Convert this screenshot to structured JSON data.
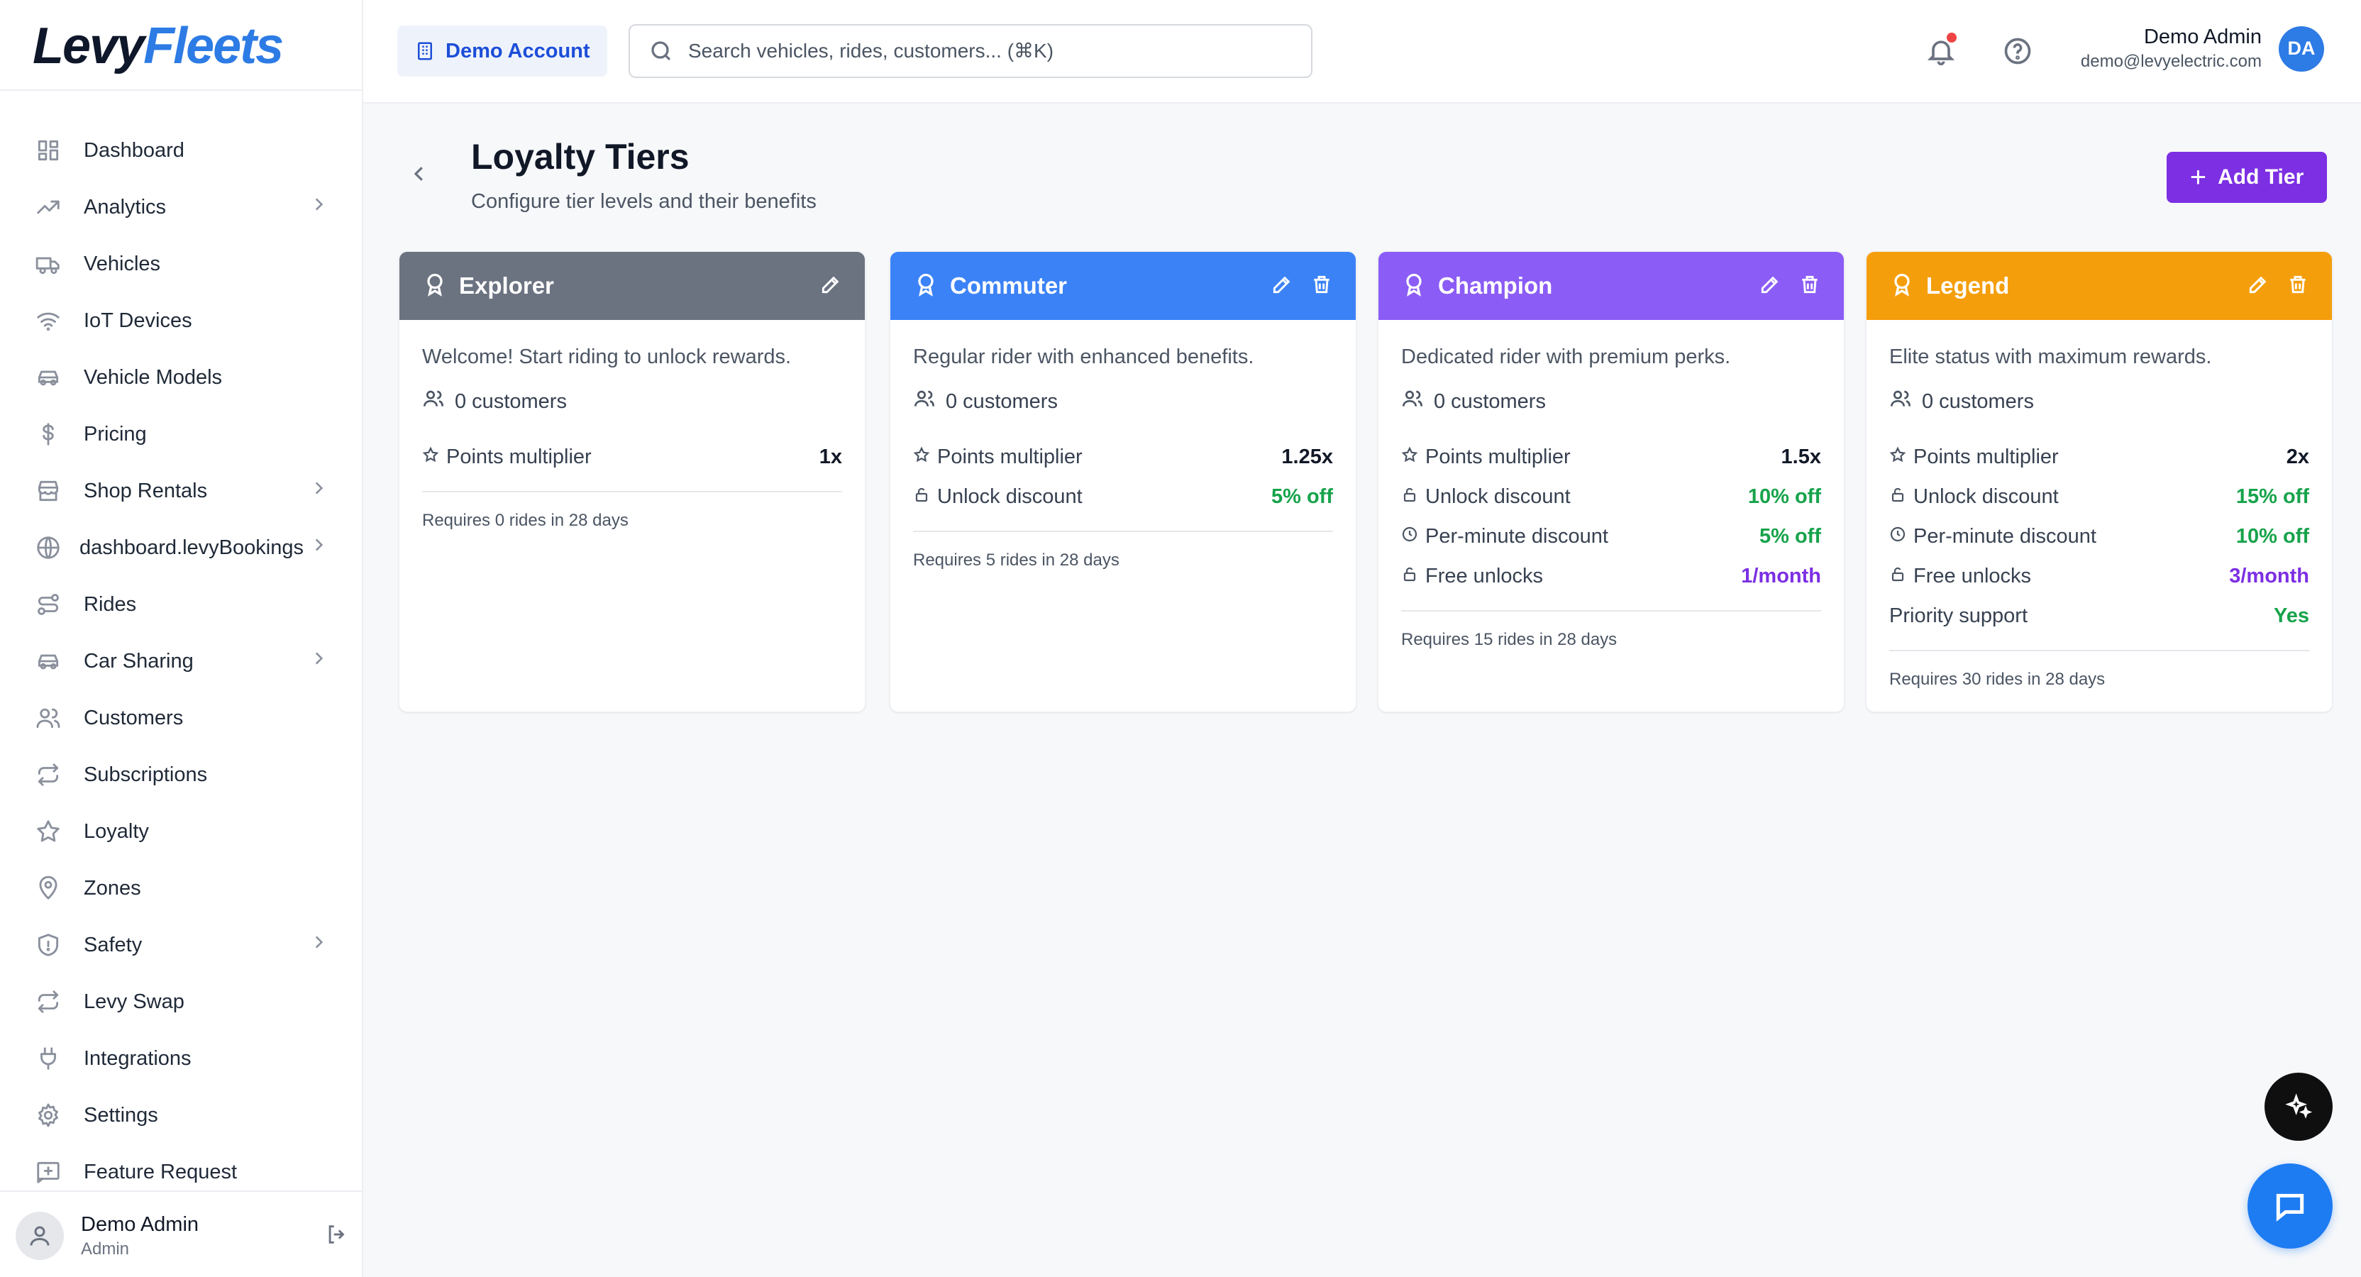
{
  "brand": {
    "part1": "Levy",
    "part2": "Fleets"
  },
  "sidebar": {
    "items": [
      {
        "label": "Dashboard",
        "icon": "grid-icon"
      },
      {
        "label": "Analytics",
        "icon": "trending-up-icon",
        "chevron": true
      },
      {
        "label": "Vehicles",
        "icon": "truck-icon"
      },
      {
        "label": "IoT Devices",
        "icon": "wifi-icon"
      },
      {
        "label": "Vehicle Models",
        "icon": "car-icon"
      },
      {
        "label": "Pricing",
        "icon": "dollar-icon"
      },
      {
        "label": "Shop Rentals",
        "icon": "store-icon",
        "chevron": true
      },
      {
        "label": "dashboard.levyBookings",
        "icon": "globe-icon",
        "chevron": true
      },
      {
        "label": "Rides",
        "icon": "route-icon"
      },
      {
        "label": "Car Sharing",
        "icon": "car-icon",
        "chevron": true
      },
      {
        "label": "Customers",
        "icon": "users-icon"
      },
      {
        "label": "Subscriptions",
        "icon": "repeat-icon"
      },
      {
        "label": "Loyalty",
        "icon": "star-icon"
      },
      {
        "label": "Zones",
        "icon": "map-pin-icon"
      },
      {
        "label": "Safety",
        "icon": "shield-icon",
        "chevron": true
      },
      {
        "label": "Levy Swap",
        "icon": "repeat-icon"
      },
      {
        "label": "Integrations",
        "icon": "plug-icon"
      },
      {
        "label": "Settings",
        "icon": "gear-icon"
      },
      {
        "label": "Feature Request",
        "icon": "message-plus-icon"
      }
    ],
    "user": {
      "name": "Demo Admin",
      "role": "Admin"
    }
  },
  "topbar": {
    "account_label": "Demo Account",
    "search_placeholder": "Search vehicles, rides, customers... (⌘K)",
    "user_name": "Demo Admin",
    "user_email": "demo@levyelectric.com",
    "user_initials": "DA"
  },
  "page": {
    "title": "Loyalty Tiers",
    "subtitle": "Configure tier levels and their benefits",
    "add_button": "Add Tier"
  },
  "tiers": [
    {
      "name": "Explorer",
      "color": "#6b7280",
      "deletable": false,
      "description": "Welcome! Start riding to unlock rewards.",
      "customers": "0 customers",
      "benefits": [
        {
          "label": "Points multiplier",
          "value": "1x",
          "icon": "star-icon",
          "tone": "dark"
        }
      ],
      "requirement": "Requires 0 rides in 28 days"
    },
    {
      "name": "Commuter",
      "color": "#3b82f6",
      "deletable": true,
      "description": "Regular rider with enhanced benefits.",
      "customers": "0 customers",
      "benefits": [
        {
          "label": "Points multiplier",
          "value": "1.25x",
          "icon": "star-icon",
          "tone": "dark"
        },
        {
          "label": "Unlock discount",
          "value": "5% off",
          "icon": "lock-icon",
          "tone": "green"
        }
      ],
      "requirement": "Requires 5 rides in 28 days"
    },
    {
      "name": "Champion",
      "color": "#8b5cf6",
      "deletable": true,
      "description": "Dedicated rider with premium perks.",
      "customers": "0 customers",
      "benefits": [
        {
          "label": "Points multiplier",
          "value": "1.5x",
          "icon": "star-icon",
          "tone": "dark"
        },
        {
          "label": "Unlock discount",
          "value": "10% off",
          "icon": "lock-icon",
          "tone": "green"
        },
        {
          "label": "Per-minute discount",
          "value": "5% off",
          "icon": "clock-icon",
          "tone": "green"
        },
        {
          "label": "Free unlocks",
          "value": "1/month",
          "icon": "lock-icon",
          "tone": "purple"
        }
      ],
      "requirement": "Requires 15 rides in 28 days"
    },
    {
      "name": "Legend",
      "color": "#f59e0b",
      "deletable": true,
      "description": "Elite status with maximum rewards.",
      "customers": "0 customers",
      "benefits": [
        {
          "label": "Points multiplier",
          "value": "2x",
          "icon": "star-icon",
          "tone": "dark"
        },
        {
          "label": "Unlock discount",
          "value": "15% off",
          "icon": "lock-icon",
          "tone": "green"
        },
        {
          "label": "Per-minute discount",
          "value": "10% off",
          "icon": "clock-icon",
          "tone": "green"
        },
        {
          "label": "Free unlocks",
          "value": "3/month",
          "icon": "lock-icon",
          "tone": "purple"
        },
        {
          "label": "Priority support",
          "value": "Yes",
          "icon": "",
          "tone": "green"
        }
      ],
      "requirement": "Requires 30 rides in 28 days"
    }
  ],
  "colors": {
    "accent": "#7c2fe3",
    "brand_blue": "#2d7be5",
    "chat": "#1d7cf2"
  }
}
